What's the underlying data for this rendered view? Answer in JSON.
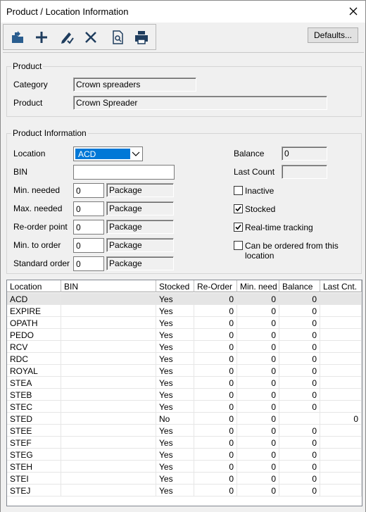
{
  "window": {
    "title": "Product / Location Information"
  },
  "toolbar": {
    "buttons": [
      {
        "icon": "open-folder-icon"
      },
      {
        "icon": "add-icon"
      },
      {
        "icon": "edit-icon"
      },
      {
        "icon": "delete-icon"
      },
      {
        "icon": "preview-icon"
      },
      {
        "icon": "print-icon"
      }
    ],
    "defaults_label": "Defaults..."
  },
  "product": {
    "group_title": "Product",
    "category_label": "Category",
    "category_value": "Crown spreaders",
    "product_label": "Product",
    "product_value": "Crown Spreader"
  },
  "info": {
    "group_title": "Product Information",
    "location_label": "Location",
    "location_value": "ACD",
    "bin_label": "BIN",
    "bin_value": "",
    "min_needed_label": "Min. needed",
    "min_needed_value": "0",
    "max_needed_label": "Max. needed",
    "max_needed_value": "0",
    "reorder_point_label": "Re-order point",
    "reorder_point_value": "0",
    "min_to_order_label": "Min. to order",
    "min_to_order_value": "0",
    "standard_order_label": "Standard order",
    "standard_order_value": "0",
    "unit": "Package",
    "balance_label": "Balance",
    "balance_value": "0",
    "last_count_label": "Last Count",
    "last_count_value": "",
    "inactive_label": "Inactive",
    "inactive_checked": false,
    "stocked_label": "Stocked",
    "stocked_checked": true,
    "realtime_label": "Real-time tracking",
    "realtime_checked": true,
    "can_order_label": "Can be ordered from this location",
    "can_order_checked": false
  },
  "grid": {
    "columns": [
      "Location",
      "BIN",
      "Stocked",
      "Re-Order",
      "Min. need",
      "Balance",
      "Last Cnt."
    ],
    "rows": [
      {
        "location": "ACD",
        "bin": "",
        "stocked": "Yes",
        "reorder": "0",
        "min_need": "0",
        "balance": "0",
        "last_cnt": ""
      },
      {
        "location": "EXPIRE",
        "bin": "",
        "stocked": "Yes",
        "reorder": "0",
        "min_need": "0",
        "balance": "0",
        "last_cnt": ""
      },
      {
        "location": "OPATH",
        "bin": "",
        "stocked": "Yes",
        "reorder": "0",
        "min_need": "0",
        "balance": "0",
        "last_cnt": ""
      },
      {
        "location": "PEDO",
        "bin": "",
        "stocked": "Yes",
        "reorder": "0",
        "min_need": "0",
        "balance": "0",
        "last_cnt": ""
      },
      {
        "location": "RCV",
        "bin": "",
        "stocked": "Yes",
        "reorder": "0",
        "min_need": "0",
        "balance": "0",
        "last_cnt": ""
      },
      {
        "location": "RDC",
        "bin": "",
        "stocked": "Yes",
        "reorder": "0",
        "min_need": "0",
        "balance": "0",
        "last_cnt": ""
      },
      {
        "location": "ROYAL",
        "bin": "",
        "stocked": "Yes",
        "reorder": "0",
        "min_need": "0",
        "balance": "0",
        "last_cnt": ""
      },
      {
        "location": "STEA",
        "bin": "",
        "stocked": "Yes",
        "reorder": "0",
        "min_need": "0",
        "balance": "0",
        "last_cnt": ""
      },
      {
        "location": "STEB",
        "bin": "",
        "stocked": "Yes",
        "reorder": "0",
        "min_need": "0",
        "balance": "0",
        "last_cnt": ""
      },
      {
        "location": "STEC",
        "bin": "",
        "stocked": "Yes",
        "reorder": "0",
        "min_need": "0",
        "balance": "0",
        "last_cnt": ""
      },
      {
        "location": "STED",
        "bin": "",
        "stocked": "No",
        "reorder": "0",
        "min_need": "0",
        "balance": "",
        "last_cnt": "0"
      },
      {
        "location": "STEE",
        "bin": "",
        "stocked": "Yes",
        "reorder": "0",
        "min_need": "0",
        "balance": "0",
        "last_cnt": ""
      },
      {
        "location": "STEF",
        "bin": "",
        "stocked": "Yes",
        "reorder": "0",
        "min_need": "0",
        "balance": "0",
        "last_cnt": ""
      },
      {
        "location": "STEG",
        "bin": "",
        "stocked": "Yes",
        "reorder": "0",
        "min_need": "0",
        "balance": "0",
        "last_cnt": ""
      },
      {
        "location": "STEH",
        "bin": "",
        "stocked": "Yes",
        "reorder": "0",
        "min_need": "0",
        "balance": "0",
        "last_cnt": ""
      },
      {
        "location": "STEI",
        "bin": "",
        "stocked": "Yes",
        "reorder": "0",
        "min_need": "0",
        "balance": "0",
        "last_cnt": ""
      },
      {
        "location": "STEJ",
        "bin": "",
        "stocked": "Yes",
        "reorder": "0",
        "min_need": "0",
        "balance": "0",
        "last_cnt": ""
      }
    ]
  },
  "colors": {
    "selection": "#0078d7",
    "selected_row": "#e5e5e5"
  }
}
